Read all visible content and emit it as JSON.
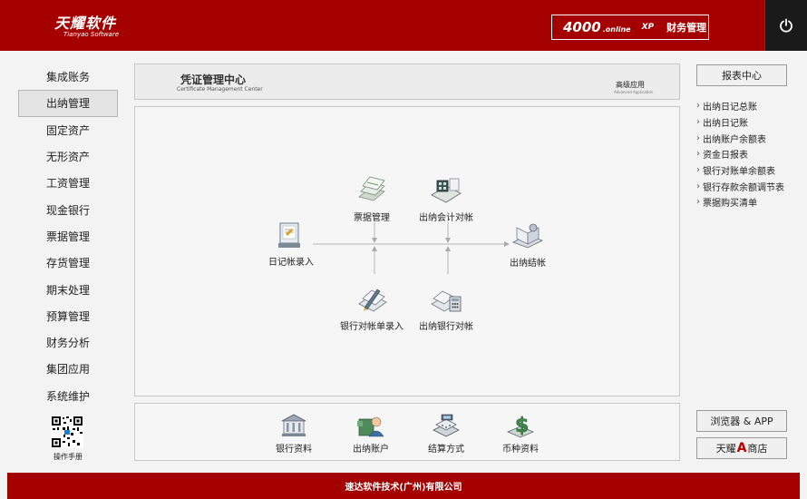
{
  "header": {
    "logo_cn": "天耀软件",
    "logo_en": "Tianyao Software",
    "product_num": "4000",
    "product_online": ".online",
    "product_xp": "XP",
    "product_name": "财务管理"
  },
  "nav": {
    "items": [
      {
        "label": "集成账务",
        "active": false
      },
      {
        "label": "出纳管理",
        "active": true
      },
      {
        "label": "固定资产",
        "active": false
      },
      {
        "label": "无形资产",
        "active": false
      },
      {
        "label": "工资管理",
        "active": false
      },
      {
        "label": "现金银行",
        "active": false
      },
      {
        "label": "票据管理",
        "active": false
      },
      {
        "label": "存货管理",
        "active": false
      },
      {
        "label": "期末处理",
        "active": false
      },
      {
        "label": "预算管理",
        "active": false
      },
      {
        "label": "财务分析",
        "active": false
      },
      {
        "label": "集团应用",
        "active": false
      },
      {
        "label": "系统维护",
        "active": false
      }
    ],
    "manual_label": "操作手册"
  },
  "title_panel": {
    "title": "凭证管理中心",
    "subtitle": "Certificate Management Center",
    "advanced": "高级应用",
    "advanced_en": "Advanced Application"
  },
  "flow": {
    "journal_entry": "日记帐录入",
    "bill_mgmt": "票据管理",
    "cashier_account_check": "出纳会计对帐",
    "cashier_close": "出纳结帐",
    "bank_statement_entry": "银行对帐单录入",
    "cashier_bank_check": "出纳银行对帐"
  },
  "bottom": {
    "items": [
      "银行资料",
      "出纳账户",
      "结算方式",
      "币种资料"
    ]
  },
  "right": {
    "report_center": "报表中心",
    "reports": [
      "出纳日记总账",
      "出纳日记账",
      "出纳账户余额表",
      "资金日报表",
      "银行对账单余额表",
      "银行存款余额调节表",
      "票据购买清单"
    ],
    "browser_app": "浏览器 & APP",
    "shop_prefix": "天耀",
    "shop_a": "A",
    "shop_suffix": "商店"
  },
  "footer": {
    "company": "速达软件技术(广州)有限公司"
  },
  "colors": {
    "brand_red": "#a40000",
    "accent_dark": "#1a1a1a",
    "background": "#f3f3f3"
  }
}
